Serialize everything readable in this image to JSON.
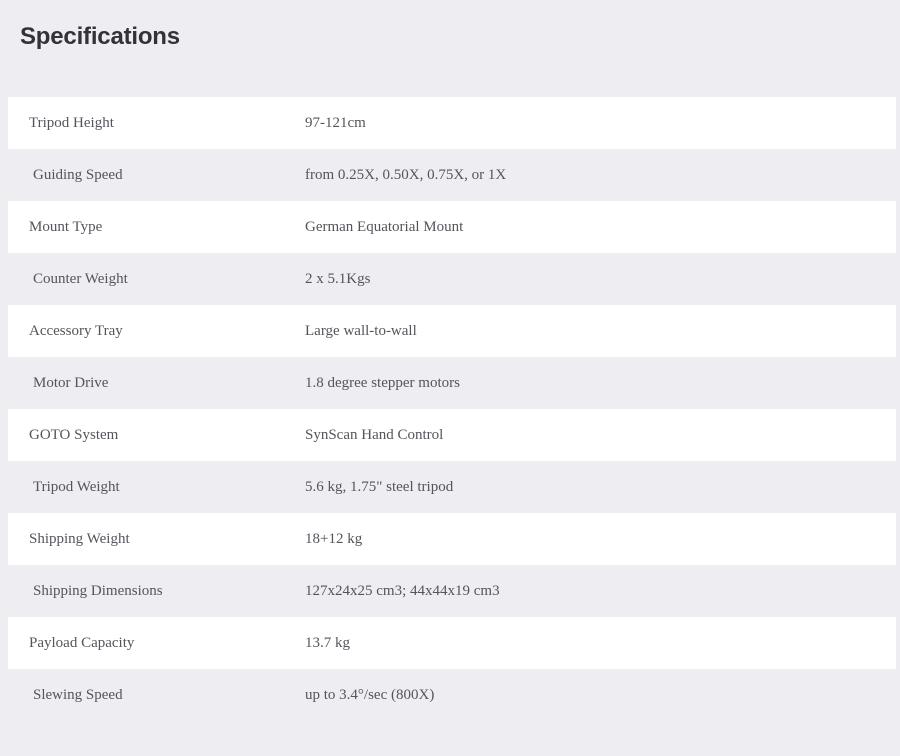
{
  "page": {
    "background_color": "#eeedf2",
    "row_light_color": "#ffffff",
    "row_dark_color": "#eeedf2",
    "text_color": "#55545c",
    "heading_color": "#333238"
  },
  "heading": {
    "title": "Specifications"
  },
  "spec_table": {
    "rows": [
      {
        "label": "Tripod Height",
        "value": "97-121cm"
      },
      {
        "label": "Guiding Speed",
        "value": "from 0.25X, 0.50X, 0.75X, or 1X"
      },
      {
        "label": "Mount Type",
        "value": "German Equatorial Mount"
      },
      {
        "label": "Counter Weight",
        "value": "2 x 5.1Kgs"
      },
      {
        "label": "Accessory Tray",
        "value": "Large wall-to-wall"
      },
      {
        "label": "Motor Drive",
        "value": "1.8 degree stepper motors"
      },
      {
        "label": "GOTO System",
        "value": "SynScan Hand Control"
      },
      {
        "label": "Tripod Weight",
        "value": "5.6 kg, 1.75\" steel tripod"
      },
      {
        "label": "Shipping Weight",
        "value": "18+12 kg"
      },
      {
        "label": "Shipping Dimensions",
        "value": "127x24x25 cm3; 44x44x19 cm3"
      },
      {
        "label": "Payload Capacity",
        "value": "13.7 kg"
      },
      {
        "label": "Slewing Speed",
        "value": "up to 3.4°/sec (800X)"
      }
    ]
  }
}
